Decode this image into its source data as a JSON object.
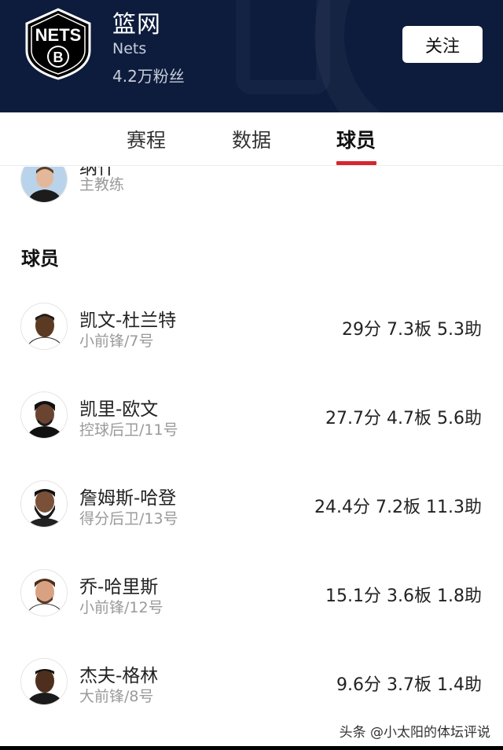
{
  "header": {
    "team_name": "篮网",
    "team_en": "Nets",
    "fans": "4.2万粉丝",
    "follow_label": "关注",
    "logo_text": "NETS",
    "colors": {
      "background": "#0d1c3d",
      "follow_bg": "#ffffff"
    }
  },
  "tabs": [
    {
      "label": "赛程",
      "active": false
    },
    {
      "label": "数据",
      "active": false
    },
    {
      "label": "球员",
      "active": true
    }
  ],
  "accent_color": "#d7262f",
  "coach": {
    "name": "纳什",
    "role": "主教练"
  },
  "players_section": {
    "title": "球员",
    "players": [
      {
        "name": "凯文-杜兰特",
        "position": "小前锋/7号",
        "stats": "29分 7.3板 5.3助"
      },
      {
        "name": "凯里-欧文",
        "position": "控球后卫/11号",
        "stats": "27.7分 4.7板 5.6助"
      },
      {
        "name": "詹姆斯-哈登",
        "position": "得分后卫/13号",
        "stats": "24.4分 7.2板 11.3助"
      },
      {
        "name": "乔-哈里斯",
        "position": "小前锋/12号",
        "stats": "15.1分 3.6板 1.8助"
      },
      {
        "name": "杰夫-格林",
        "position": "大前锋/8号",
        "stats": "9.6分 3.7板 1.4助"
      }
    ]
  },
  "watermark": "头条 @小太阳的体坛评说"
}
